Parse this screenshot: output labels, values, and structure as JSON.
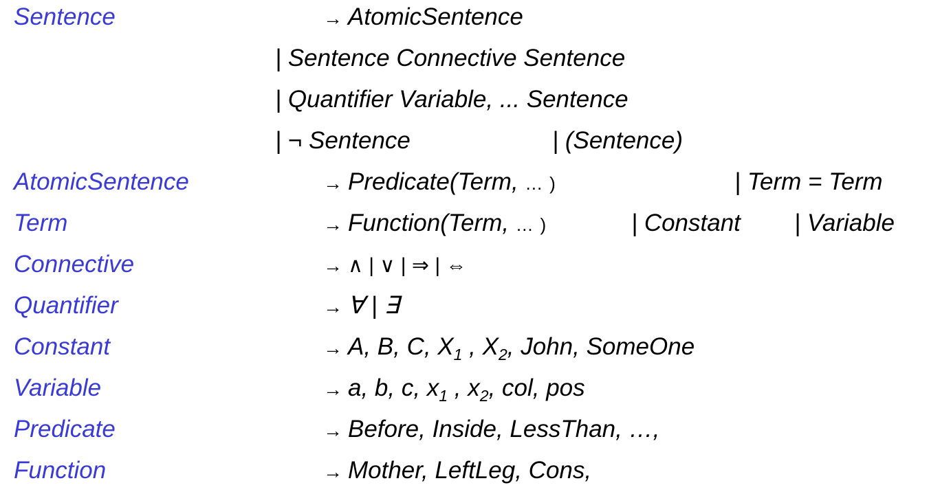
{
  "rows": {
    "sentence": {
      "lhs": "Sentence",
      "arrow": "→",
      "rhs": "AtomicSentence"
    },
    "sentence_alt1": "| Sentence Connective Sentence",
    "sentence_alt2": "| Quantifier Variable, ... Sentence",
    "sentence_alt3a": "| ¬ Sentence",
    "sentence_alt3b": "| (Sentence)",
    "atomic": {
      "lhs": "AtomicSentence",
      "arrow": "→",
      "rhs_a": "Predicate(Term, ",
      "rhs_ellipsis": "…",
      "rhs_close": ")",
      "rhs_b": "| Term = Term"
    },
    "term": {
      "lhs": "Term",
      "arrow": "→",
      "rhs_a": "Function(Term, ",
      "rhs_ellipsis": "…",
      "rhs_close": ")",
      "rhs_b": "| Constant",
      "rhs_c": "| Variable"
    },
    "connective": {
      "lhs": "Connective",
      "arrow": "→",
      "rhs": "∧ | ∨ | ⇒ | ⇔"
    },
    "quantifier": {
      "lhs": "Quantifier",
      "arrow": "→",
      "rhs": "∀ | ∃"
    },
    "constant": {
      "lhs": "Constant",
      "arrow": "→",
      "rhs_a": "A, B, C, X",
      "sub1": "1",
      "rhs_b": " , X",
      "sub2": "2",
      "rhs_c": ", John, SomeOne"
    },
    "variable": {
      "lhs": "Variable",
      "arrow": "→",
      "rhs_a": "a, b, c, x",
      "sub1": "1",
      "rhs_b": " , x",
      "sub2": "2",
      "rhs_c": ", col, pos"
    },
    "predicate": {
      "lhs": "Predicate",
      "arrow": "→",
      "rhs": "Before, Inside, LessThan, …,"
    },
    "function": {
      "lhs": "Function",
      "arrow": "→",
      "rhs": "Mother, LeftLeg, Cons,"
    }
  },
  "colors": {
    "nonterminal": "#3a3ad6",
    "text": "#000000"
  }
}
